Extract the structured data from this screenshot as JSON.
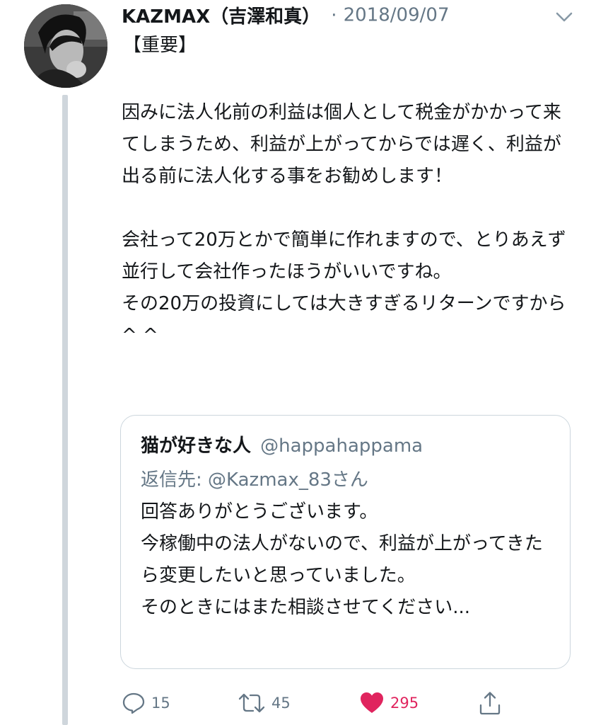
{
  "tweet": {
    "author_name": "KAZMAX（吉澤和真）",
    "separator": "·",
    "date": "2018/09/07",
    "tag": "【重要】",
    "paragraphs": [
      "因みに法人化前の利益は個人として税金がかかって来てしまうため、利益が上がってからでは遅く、利益が出る前に法人化する事をお勧めします！",
      "会社って20万とかで簡単に作れますので、とりあえず並行して会社作ったほうがいいですね。",
      "その20万の投資にしては大きすぎるリターンですから^ ^"
    ]
  },
  "quoted_tweet": {
    "author_name": "猫が好きな人",
    "handle": "@happahappama",
    "reply_to": "返信先: @Kazmax_83さん",
    "text": "回答ありがとうございます。\n今稼働中の法人がないので、利益が上がってきたら変更したいと思っていました。\nそのときにはまた相談させてください..."
  },
  "actions": {
    "replies": "15",
    "retweets": "45",
    "likes": "295"
  },
  "colors": {
    "primary_text": "#14171a",
    "secondary_text": "#657786",
    "like_red": "#e0245e",
    "border": "#ccd6dd",
    "thread_line": "#cfd6dc"
  },
  "icons": {
    "reply": "reply-icon",
    "retweet": "retweet-icon",
    "like": "heart-icon",
    "share": "share-icon",
    "menu": "chevron-down-icon"
  }
}
